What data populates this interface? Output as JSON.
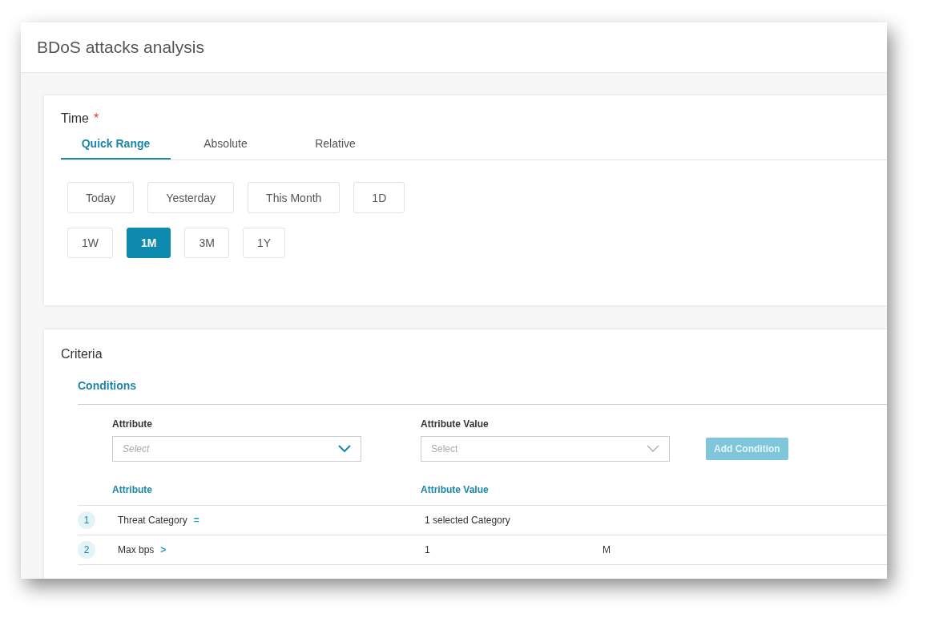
{
  "window": {
    "title": "BDoS attacks analysis"
  },
  "time": {
    "label": "Time",
    "required": "*",
    "tabs": [
      {
        "label": "Quick Range",
        "selected": true
      },
      {
        "label": "Absolute",
        "selected": false
      },
      {
        "label": "Relative",
        "selected": false
      }
    ],
    "ranges": [
      [
        {
          "label": "Today",
          "selected": false
        },
        {
          "label": "Yesterday",
          "selected": false
        },
        {
          "label": "This Month",
          "selected": false
        },
        {
          "label": "1D",
          "selected": false
        }
      ],
      [
        {
          "label": "1W",
          "selected": false
        },
        {
          "label": "1M",
          "selected": true
        },
        {
          "label": "3M",
          "selected": false
        },
        {
          "label": "1Y",
          "selected": false
        }
      ]
    ]
  },
  "criteria": {
    "title": "Criteria",
    "subtitle": "Conditions",
    "selects": [
      {
        "label": "Attribute",
        "placeholder": "Select",
        "disabled": false
      },
      {
        "label": "Attribute Value",
        "placeholder": "Select",
        "disabled": true
      }
    ],
    "add_button": {
      "label": "Add Condition",
      "disabled": true
    },
    "table": {
      "columns": [
        "Attribute",
        "Attribute Value"
      ],
      "rows": [
        {
          "index": "1",
          "attribute": "Threat Category",
          "operator": "=",
          "value": "1 selected Category"
        },
        {
          "index": "2",
          "attribute": "Max bps",
          "operator": ">",
          "value": "1",
          "unit": "M"
        }
      ]
    }
  }
}
